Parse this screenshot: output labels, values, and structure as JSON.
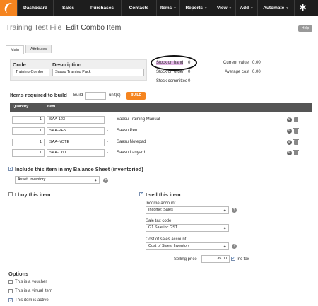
{
  "nav": {
    "items": [
      {
        "label": "Dashboard",
        "caret": false
      },
      {
        "label": "Sales",
        "caret": false
      },
      {
        "label": "Purchases",
        "caret": false
      },
      {
        "label": "Contacts",
        "caret": false
      },
      {
        "label": "Items",
        "caret": true
      },
      {
        "label": "Reports",
        "caret": true
      },
      {
        "label": "View",
        "caret": true
      },
      {
        "label": "Add",
        "caret": true
      },
      {
        "label": "Automate",
        "caret": true
      }
    ],
    "logo_icon": "saasu-logo-icon",
    "settings_icon": "gear-icon",
    "accent": "#f5841f"
  },
  "header": {
    "file_name": "Training Test File",
    "page_title": "Edit Combo Item",
    "help_label": "Help"
  },
  "tabs": [
    {
      "label": "Main",
      "active": true
    },
    {
      "label": "Attributes",
      "active": false
    }
  ],
  "item": {
    "code_label": "Code",
    "description_label": "Description",
    "code_value": "Training-Combo",
    "description_value": "Saasu Training Pack"
  },
  "stock": {
    "on_hand_label": "Stock on hand",
    "on_hand_value": "0",
    "on_order_label": "Stock on order",
    "on_order_value": "0",
    "committed_label": "Stock committed",
    "committed_value": "0",
    "current_value_label": "Current value",
    "current_value": "0.00",
    "average_cost_label": "Average cost",
    "average_cost": "0.00"
  },
  "build": {
    "heading": "Items required to build",
    "build_label": "Build",
    "units_label": "unit(s)",
    "button_label": "BUILD",
    "quantity_value": ""
  },
  "components": {
    "columns": [
      "Quantity",
      "Item"
    ],
    "rows": [
      {
        "quantity": "1",
        "code": "SAA-123",
        "name": "Saasu Training Manual"
      },
      {
        "quantity": "1",
        "code": "SAA-PEN",
        "name": "Saasu Pen"
      },
      {
        "quantity": "1",
        "code": "SAA-NOTE",
        "name": "Saasu Notepad"
      },
      {
        "quantity": "1",
        "code": "SAA-LYD",
        "name": "Saasu Lanyard"
      }
    ],
    "separator": "-"
  },
  "inventory": {
    "include_label": "Include this item in my Balance Sheet (inventoried)",
    "include_checked": true,
    "asset_account": "Asset: Inventory"
  },
  "buy": {
    "label": "I buy this item",
    "checked": false
  },
  "sell": {
    "label": "I sell this item",
    "checked": true,
    "income_account_label": "Income account",
    "income_account": "Income: Sales",
    "sale_tax_code_label": "Sale tax code",
    "sale_tax_code": "G1 Sale inc GST",
    "cost_of_sales_label": "Cost of sales account",
    "cost_of_sales_account": "Cost of Sales: Inventory",
    "selling_price_label": "Selling price",
    "selling_price": "35.00",
    "inc_tax_label": "Inc tax",
    "inc_tax_checked": true
  },
  "options": {
    "heading": "Options",
    "items": [
      {
        "label": "This is a voucher",
        "checked": false
      },
      {
        "label": "This is a virtual item",
        "checked": false
      },
      {
        "label": "This item is active",
        "checked": true
      }
    ]
  }
}
